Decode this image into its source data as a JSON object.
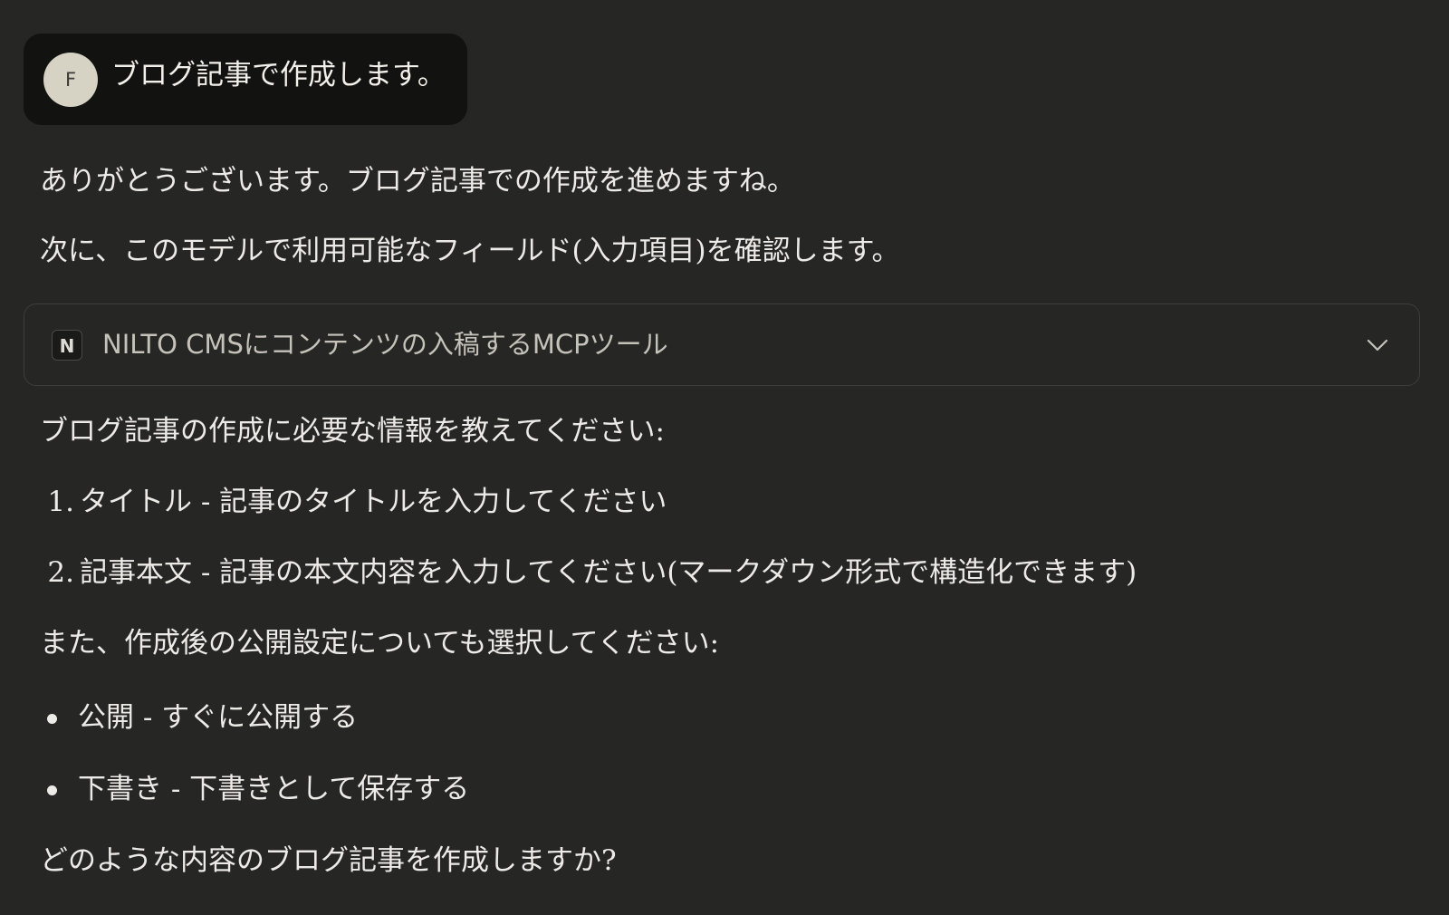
{
  "user_message": {
    "avatar_initial": "F",
    "text": "ブログ記事で作成します。"
  },
  "assistant": {
    "intro": "ありがとうございます。ブログ記事での作成を進めますね。",
    "next_step": "次に、このモデルで利用可能なフィールド(入力項目)を確認します。",
    "tool_call": {
      "badge": "N",
      "label": "NILTO CMSにコンテンツの入稿するMCPツール",
      "icon": "chevron-down-icon"
    },
    "request": "ブログ記事の作成に必要な情報を教えてください:",
    "fields": [
      {
        "number": "1.",
        "text": "タイトル - 記事のタイトルを入力してください"
      },
      {
        "number": "2.",
        "text": "記事本文 - 記事の本文内容を入力してください(マークダウン形式で構造化できます)"
      }
    ],
    "publish_prompt": "また、作成後の公開設定についても選択してください:",
    "publish_options": [
      {
        "text": "公開 - すぐに公開する"
      },
      {
        "text": "下書き - 下書きとして保存する"
      }
    ],
    "closing": "どのような内容のブログ記事を作成しますか?"
  }
}
